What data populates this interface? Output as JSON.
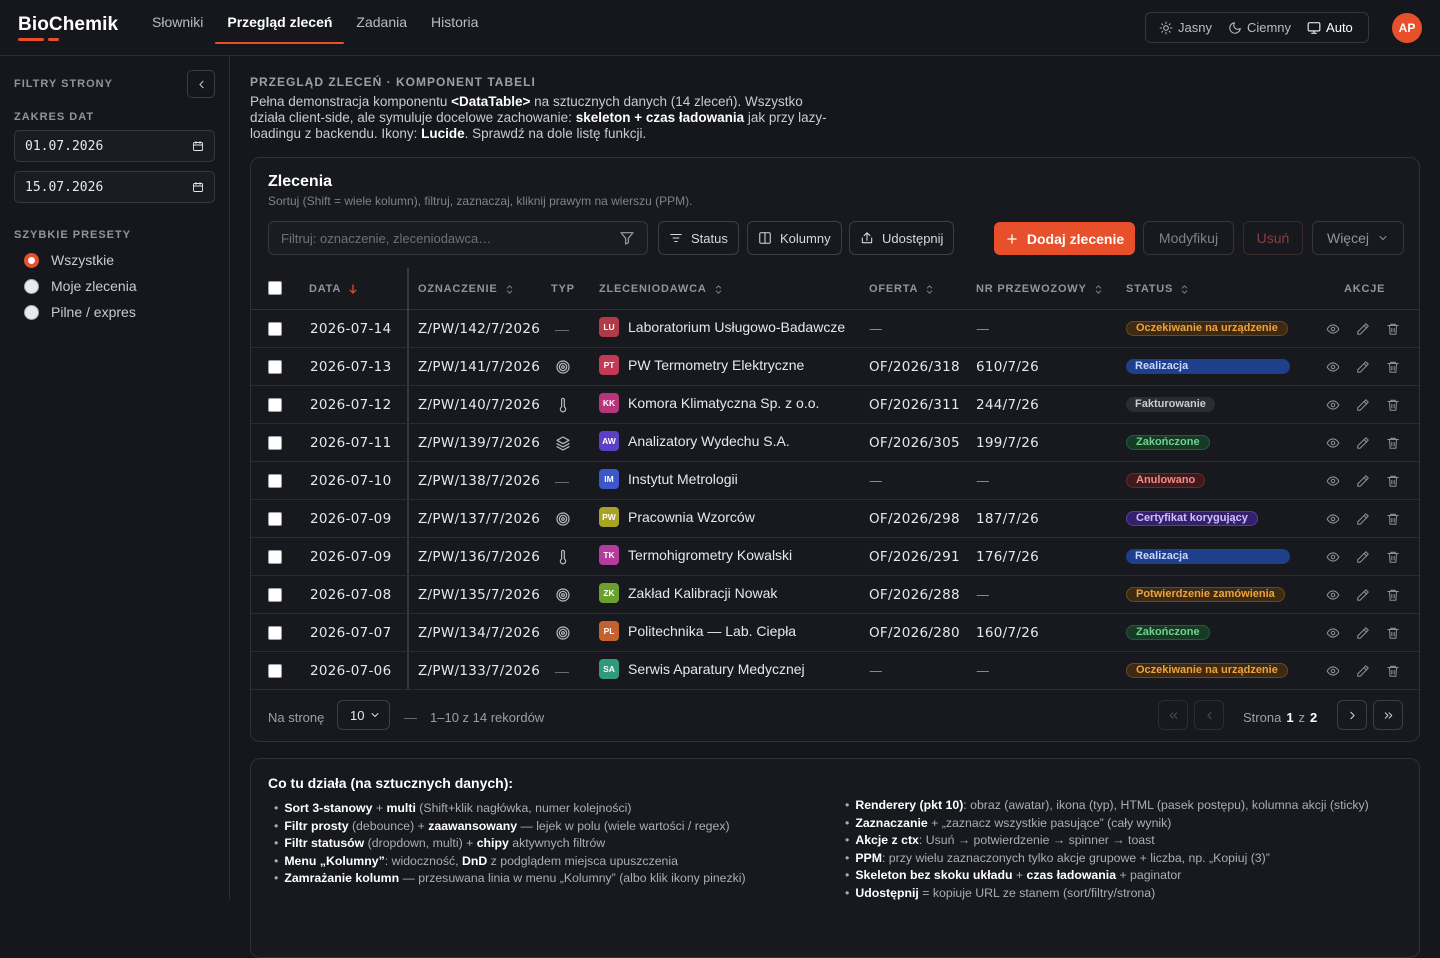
{
  "app": {
    "logo": "BioChemik"
  },
  "nav": [
    "Słowniki",
    "Przegląd zleceń",
    "Zadania",
    "Historia"
  ],
  "theme": {
    "light": "Jasny",
    "dark": "Ciemny",
    "auto": "Auto"
  },
  "user": {
    "initials": "AP"
  },
  "sidebar": {
    "title": "FILTRY STRONY",
    "date_label": "ZAKRES DAT",
    "date_from": "01.07.2026",
    "date_to": "15.07.2026",
    "presets_label": "SZYBKIE PRESETY",
    "presets": [
      "Wszystkie",
      "Moje zlecenia",
      "Pilne / expres"
    ]
  },
  "page": {
    "kicker": "PRZEGLĄD ZLECEŃ · KOMPONENT TABELI",
    "desc": {
      "a": "Pełna demonstracja komponentu ",
      "b": "<DataTable>",
      "c": " na sztucznych danych (14 zleceń). Wszystko działa client-side, ale symuluje docelowe zachowanie: ",
      "d": "skeleton + czas ładowania",
      "e": " jak przy lazy-loadingu z backendu. Ikony: ",
      "f": "Lucide",
      "g": ". Sprawdź na dole listę funkcji."
    }
  },
  "table_card": {
    "title": "Zlecenia",
    "subtitle": "Sortuj (Shift = wiele kolumn), filtruj, zaznaczaj, kliknij prawym na wierszu (PPM).",
    "filter_placeholder": "Filtruj: oznaczenie, zleceniodawca…",
    "btn_status": "Status",
    "btn_columns": "Kolumny",
    "btn_share": "Udostępnij",
    "btn_add": "Dodaj zlecenie",
    "btn_modify": "Modyfikuj",
    "btn_delete": "Usuń",
    "btn_more": "Więcej"
  },
  "columns": [
    "DATA",
    "OZNACZENIE",
    "TYP",
    "ZLECENIODAWCA",
    "OFERTA",
    "NR PRZEWOZOWY",
    "STATUS",
    "AKCJE"
  ],
  "rows": [
    {
      "date": "2026-07-14",
      "code": "Z/PW/142/7/2026",
      "type": "none",
      "ini": "LU",
      "color": "#b03a48",
      "client": "Laboratorium Usługowo-Badawcze",
      "offer": "—",
      "transport": "—",
      "status": "Oczekiwanie na urządzenie",
      "status_kind": "orange"
    },
    {
      "date": "2026-07-13",
      "code": "Z/PW/141/7/2026",
      "type": "target",
      "ini": "PT",
      "color": "#c23a55",
      "client": "PW Termometry Elektryczne",
      "offer": "OF/2026/318",
      "transport": "610/7/26",
      "status": "Realizacja",
      "status_kind": "blue"
    },
    {
      "date": "2026-07-12",
      "code": "Z/PW/140/7/2026",
      "type": "thermo",
      "ini": "KK",
      "color": "#b8357a",
      "client": "Komora Klimatyczna Sp. z o.o.",
      "offer": "OF/2026/311",
      "transport": "244/7/26",
      "status": "Fakturowanie",
      "status_kind": "gray"
    },
    {
      "date": "2026-07-11",
      "code": "Z/PW/139/7/2026",
      "type": "layers",
      "ini": "AW",
      "color": "#5b3fc4",
      "client": "Analizatory Wydechu S.A.",
      "offer": "OF/2026/305",
      "transport": "199/7/26",
      "status": "Zakończone",
      "status_kind": "green"
    },
    {
      "date": "2026-07-10",
      "code": "Z/PW/138/7/2026",
      "type": "none",
      "ini": "IM",
      "color": "#3b57c9",
      "client": "Instytut Metrologii",
      "offer": "—",
      "transport": "—",
      "status": "Anulowano",
      "status_kind": "red"
    },
    {
      "date": "2026-07-09",
      "code": "Z/PW/137/7/2026",
      "type": "target",
      "ini": "PW",
      "color": "#a8a226",
      "client": "Pracownia Wzorców",
      "offer": "OF/2026/298",
      "transport": "187/7/26",
      "status": "Certyfikat korygujący",
      "status_kind": "purple"
    },
    {
      "date": "2026-07-09",
      "code": "Z/PW/136/7/2026",
      "type": "thermo",
      "ini": "TK",
      "color": "#b53c9c",
      "client": "Termohigrometry Kowalski",
      "offer": "OF/2026/291",
      "transport": "176/7/26",
      "status": "Realizacja",
      "status_kind": "blue"
    },
    {
      "date": "2026-07-08",
      "code": "Z/PW/135/7/2026",
      "type": "target",
      "ini": "ZK",
      "color": "#6aa12c",
      "client": "Zakład Kalibracji Nowak",
      "offer": "OF/2026/288",
      "transport": "—",
      "status": "Potwierdzenie zamówienia",
      "status_kind": "orange"
    },
    {
      "date": "2026-07-07",
      "code": "Z/PW/134/7/2026",
      "type": "target",
      "ini": "PL",
      "color": "#c4622f",
      "client": "Politechnika — Lab. Ciepła",
      "offer": "OF/2026/280",
      "transport": "160/7/26",
      "status": "Zakończone",
      "status_kind": "green"
    },
    {
      "date": "2026-07-06",
      "code": "Z/PW/133/7/2026",
      "type": "none",
      "ini": "SA",
      "color": "#2f9a7c",
      "client": "Serwis Aparatury Medycznej",
      "offer": "—",
      "transport": "—",
      "status": "Oczekiwanie na urządzenie",
      "status_kind": "orange"
    }
  ],
  "pagination": {
    "per_page_label": "Na stronę",
    "per_page": "10",
    "dash": "—",
    "range": "1–10 z 14 rekordów",
    "page_word": "Strona",
    "page": "1",
    "of_word": "z",
    "pages": "2"
  },
  "info": {
    "title": "Co tu działa (na sztucznych danych):",
    "left": [
      [
        {
          "b": "Sort 3-stanowy"
        },
        {
          "t": " + "
        },
        {
          "b": "multi"
        },
        {
          "t": " (Shift+klik nagłówka, numer kolejności)"
        }
      ],
      [
        {
          "b": "Filtr prosty"
        },
        {
          "t": " (debounce) + "
        },
        {
          "b": "zaawansowany"
        },
        {
          "t": " — lejek w polu (wiele wartości / regex)"
        }
      ],
      [
        {
          "b": "Filtr statusów"
        },
        {
          "t": " (dropdown, multi) + "
        },
        {
          "b": "chipy"
        },
        {
          "t": " aktywnych filtrów"
        }
      ],
      [
        {
          "b": "Menu „Kolumny”"
        },
        {
          "t": ": widoczność, "
        },
        {
          "b": "DnD"
        },
        {
          "t": " z podglądem miejsca upuszczenia"
        }
      ],
      [
        {
          "b": "Zamrażanie kolumn"
        },
        {
          "t": " — przesuwana linia w menu „Kolumny” (albo klik ikony pinezki)"
        }
      ]
    ],
    "right": [
      [
        {
          "b": "Renderery (pkt 10)"
        },
        {
          "t": ": obraz (awatar), ikona (typ), HTML (pasek postępu), kolumna akcji (sticky)"
        }
      ],
      [
        {
          "b": "Zaznaczanie"
        },
        {
          "t": " + „zaznacz wszystkie pasujące” (cały wynik)"
        }
      ],
      [
        {
          "b": "Akcje z ctx"
        },
        {
          "t": ": Usuń → potwierdzenie → spinner → toast"
        }
      ],
      [
        {
          "b": "PPM"
        },
        {
          "t": ": przy wielu zaznaczonych tylko akcje grupowe + liczba, np. „Kopiuj (3)”"
        }
      ],
      [
        {
          "b": "Skeleton bez skoku układu"
        },
        {
          "t": " + "
        },
        {
          "b": "czas ładowania"
        },
        {
          "t": " + paginator"
        }
      ],
      [
        {
          "b": "Udostępnij"
        },
        {
          "t": " = kopiuje URL ze stanem (sort/filtry/strona)"
        }
      ]
    ]
  },
  "colors": {
    "accent": "#e8502c",
    "bg": "#15171c",
    "card": "#17191e",
    "border": "#2e3139"
  }
}
